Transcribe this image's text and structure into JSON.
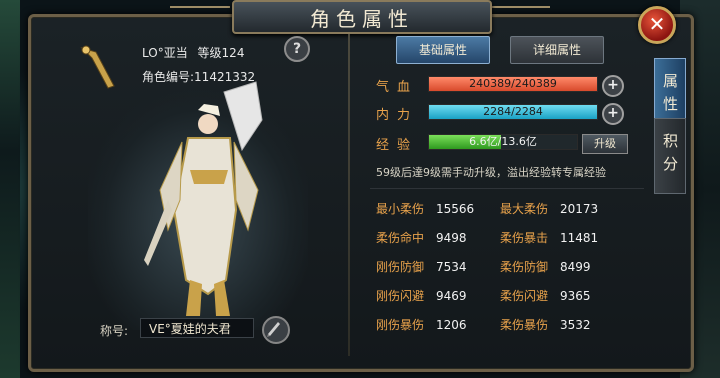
{
  "window": {
    "title": "角色属性",
    "close_icon": "close-icon"
  },
  "character": {
    "name": "LO°亚当",
    "level_label": "等级124",
    "id_label": "角色编号:",
    "id_value": "11421332",
    "title_label": "称号:",
    "title_value": "VE°夏娃的夫君",
    "help_label": "?"
  },
  "tabs": {
    "basic": "基础属性",
    "detail": "详细属性"
  },
  "side_tabs": {
    "attributes": "属性",
    "points": "积分"
  },
  "vitals": {
    "hp_label": "气血",
    "hp_value": "240389/240389",
    "mp_label": "内力",
    "mp_value": "2284/2284",
    "exp_label": "经验",
    "exp_value": "6.6亿/13.6亿",
    "exp_fraction": 0.485,
    "upgrade_label": "升级",
    "plus": "+"
  },
  "notice": "59级后達9级需手动升级，溢出经验转专属经验",
  "attributes": [
    {
      "label": "最小柔伤",
      "value": "15566"
    },
    {
      "label": "最大柔伤",
      "value": "20173"
    },
    {
      "label": "柔伤命中",
      "value": "9498"
    },
    {
      "label": "柔伤暴击",
      "value": "11481"
    },
    {
      "label": "刚伤防御",
      "value": "7534"
    },
    {
      "label": "柔伤防御",
      "value": "8499"
    },
    {
      "label": "刚伤闪避",
      "value": "9469"
    },
    {
      "label": "柔伤闪避",
      "value": "9365"
    },
    {
      "label": "刚伤暴伤",
      "value": "1206"
    },
    {
      "label": "柔伤暴伤",
      "value": "3532"
    }
  ],
  "colors": {
    "accent_label": "#e8a24b",
    "hp": "#d84a2c",
    "mp": "#1aa2c4",
    "exp": "#2f9a1f",
    "active_tab": "#25466a"
  }
}
